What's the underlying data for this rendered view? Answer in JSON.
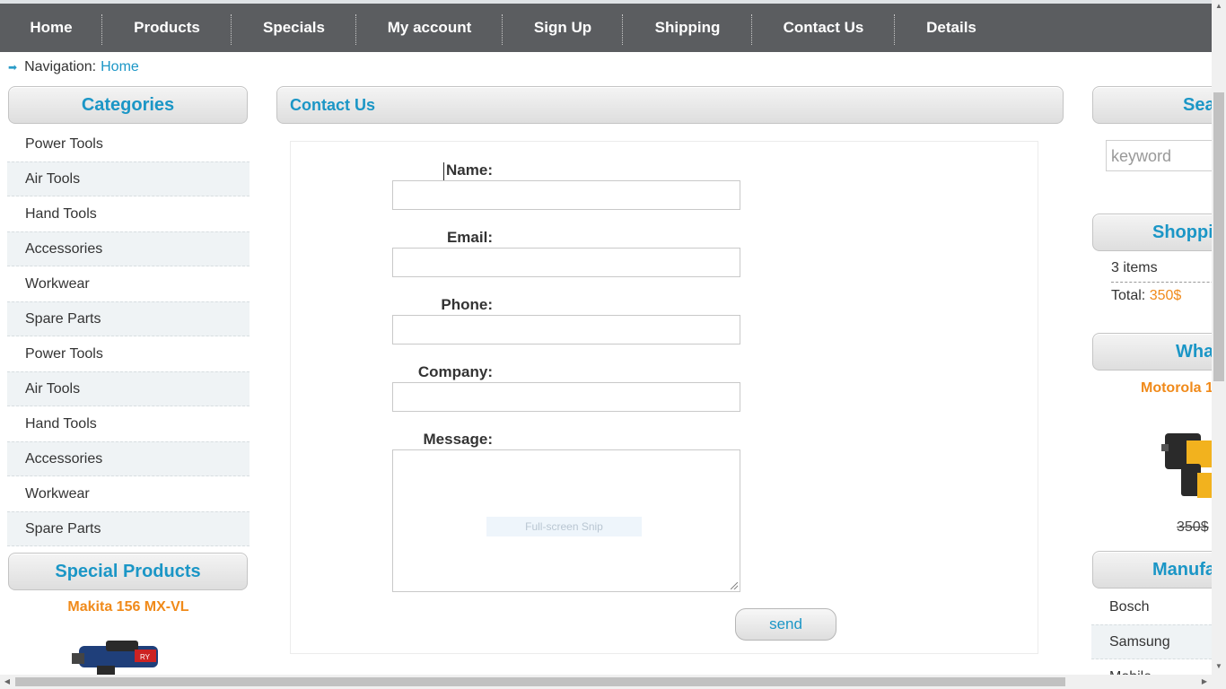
{
  "nav": {
    "items": [
      {
        "label": "Home"
      },
      {
        "label": "Products"
      },
      {
        "label": "Specials"
      },
      {
        "label": "My account"
      },
      {
        "label": "Sign Up"
      },
      {
        "label": "Shipping"
      },
      {
        "label": "Contact Us"
      },
      {
        "label": "Details"
      }
    ]
  },
  "breadcrumb": {
    "label": "Navigation:",
    "link": "Home"
  },
  "categories": {
    "title": "Categories",
    "items": [
      "Power Tools",
      "Air Tools",
      "Hand Tools",
      "Accessories",
      "Workwear",
      "Spare Parts",
      "Power Tools",
      "Air Tools",
      "Hand Tools",
      "Accessories",
      "Workwear",
      "Spare Parts"
    ]
  },
  "special": {
    "title": "Special Products",
    "product_name": "Makita 156 MX-VL"
  },
  "contact": {
    "title": "Contact Us",
    "fields": {
      "name": "Name:",
      "email": "Email:",
      "phone": "Phone:",
      "company": "Company:",
      "message": "Message:"
    },
    "snip_overlay": "Full-screen Snip",
    "send_label": "send"
  },
  "search": {
    "title": "Sea",
    "placeholder": "keyword"
  },
  "cart": {
    "title": "Shoppi",
    "items_text": "3 items",
    "total_label": "Total:",
    "total_value": "350$"
  },
  "whats_new": {
    "title": "What'",
    "product_name": "Motorola 1",
    "price": "350$"
  },
  "manufacturers": {
    "title": "Manufa",
    "items": [
      "Bosch",
      "Samsung",
      "Mobile"
    ]
  },
  "colors": {
    "accent": "#1b96c6",
    "price": "#f08a1a",
    "navbar": "#5b5d60"
  }
}
